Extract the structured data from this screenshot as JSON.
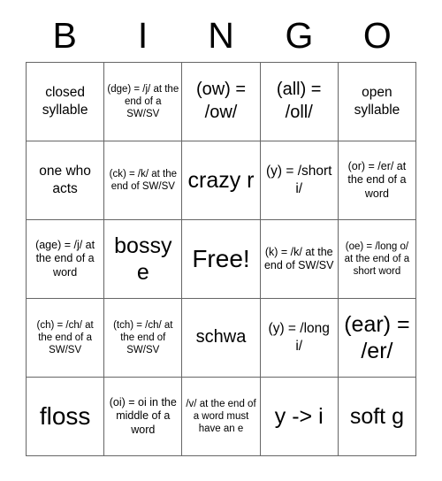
{
  "header": {
    "letters": [
      "B",
      "I",
      "N",
      "G",
      "O"
    ]
  },
  "grid": {
    "rows": [
      [
        {
          "text": "closed syllable",
          "size": "md"
        },
        {
          "text": "(dge) = /j/ at the end of a SW/SV",
          "size": "xs"
        },
        {
          "text": "(ow) = /ow/",
          "size": "lg"
        },
        {
          "text": "(all) = /oll/",
          "size": "lg"
        },
        {
          "text": "open syllable",
          "size": "md"
        }
      ],
      [
        {
          "text": "one who acts",
          "size": "md"
        },
        {
          "text": "(ck) = /k/ at the end of SW/SV",
          "size": "xs"
        },
        {
          "text": "crazy r",
          "size": "xl"
        },
        {
          "text": "(y) = /short i/",
          "size": "md"
        },
        {
          "text": "(or) = /er/ at the end of a word",
          "size": "sm"
        }
      ],
      [
        {
          "text": "(age) = /j/ at the end of a word",
          "size": "sm"
        },
        {
          "text": "bossy e",
          "size": "xl"
        },
        {
          "text": "Free!",
          "size": "xxl"
        },
        {
          "text": "(k) = /k/ at the end of SW/SV",
          "size": "sm"
        },
        {
          "text": "(oe) = /long o/ at the end of a short word",
          "size": "xs"
        }
      ],
      [
        {
          "text": "(ch) = /ch/ at the end of a SW/SV",
          "size": "xs"
        },
        {
          "text": "(tch) = /ch/ at the end of SW/SV",
          "size": "xs"
        },
        {
          "text": "schwa",
          "size": "lg"
        },
        {
          "text": "(y) = /long i/",
          "size": "md"
        },
        {
          "text": "(ear) = /er/",
          "size": "xl"
        }
      ],
      [
        {
          "text": "floss",
          "size": "xxl"
        },
        {
          "text": "(oi) = oi in the middle of a word",
          "size": "sm"
        },
        {
          "text": "/v/ at the end of a word must have an e",
          "size": "xs"
        },
        {
          "text": "y -> i",
          "size": "xl"
        },
        {
          "text": "soft g",
          "size": "xl"
        }
      ]
    ]
  },
  "colors": {
    "border": "#666666",
    "text": "#000000",
    "background": "#ffffff"
  }
}
